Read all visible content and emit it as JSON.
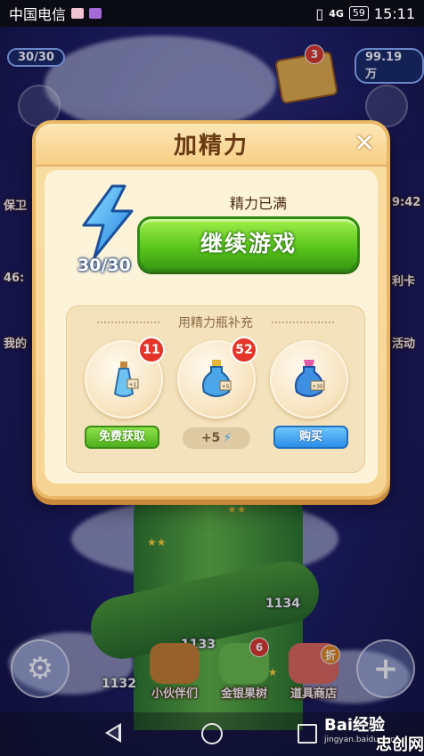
{
  "status_bar": {
    "carrier": "中国电信",
    "network": "4G",
    "battery": "59",
    "time": "15:11"
  },
  "background": {
    "energy_pill": "30/30",
    "coins_pill": "99.19万",
    "mail_badge": "3",
    "left_items": [
      {
        "label": "保卫"
      },
      {
        "label": "46:"
      },
      {
        "label": "我的"
      }
    ],
    "right_items": [
      {
        "label": "9:42"
      },
      {
        "label": "利卡"
      },
      {
        "label": "活动"
      }
    ],
    "level_numbers": [
      "1134",
      "1133",
      "1132"
    ],
    "bottom_items": [
      {
        "label": "小伙伴们",
        "badge": ""
      },
      {
        "label": "金银果树",
        "badge": "6"
      },
      {
        "label": "道具商店",
        "badge": "折"
      }
    ],
    "settings_icon": "gear-icon",
    "add_icon": "plus-icon"
  },
  "dialog": {
    "title": "加精力",
    "close_label": "✕",
    "energy_count": "30/30",
    "energy_status": "精力已满",
    "continue_button": "继续游戏",
    "refill_title": "用精力瓶补充",
    "bottles": [
      {
        "name": "small",
        "count": "11",
        "amount": "+1"
      },
      {
        "name": "medium",
        "count": "52",
        "amount": "+5"
      },
      {
        "name": "large",
        "count": "",
        "amount": "+30"
      }
    ],
    "free_button": "免费获取",
    "plus_value": "+5",
    "buy_button": "购买"
  },
  "navbar": {
    "watermark": "Bai经验",
    "watermark_sub": "jingyan.baidu.com",
    "site_mark": "忠创网"
  },
  "colors": {
    "dialog_bg": "#f9dea2",
    "continue_green": "#5cc71d",
    "buy_blue": "#2a8ee6",
    "badge_red": "#e5352a"
  }
}
